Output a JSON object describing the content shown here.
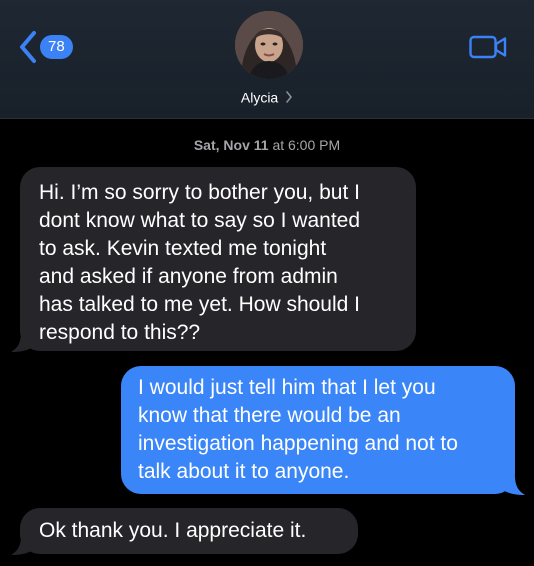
{
  "header": {
    "back_badge": "78",
    "contact_name": "Alycia",
    "back_icon": "chevron-left-icon",
    "video_icon": "video-camera-icon",
    "name_chevron_icon": "chevron-right-icon",
    "accent_color": "#3b82f6"
  },
  "conversation": {
    "timestamp_day": "Sat, Nov 11",
    "timestamp_time": "at 6:00 PM",
    "messages": [
      {
        "direction": "incoming",
        "lines": [
          "Hi. I’m so sorry to bother you, but I",
          "dont know what to say so I wanted",
          "to ask. Kevin texted me tonight",
          "and asked if anyone from admin",
          "has talked to me yet. How should I",
          "respond to this??"
        ]
      },
      {
        "direction": "outgoing",
        "lines": [
          "I would just tell him that I let you",
          "know that there would be an",
          "investigation happening and not to",
          "talk about it to anyone."
        ]
      },
      {
        "direction": "incoming",
        "lines": [
          "Ok thank you. I appreciate it."
        ]
      }
    ]
  },
  "colors": {
    "incoming_bubble": "#26252a",
    "outgoing_bubble": "#3a86f8",
    "header_background": "#1f2732",
    "timestamp_text": "#a5a5aa"
  }
}
